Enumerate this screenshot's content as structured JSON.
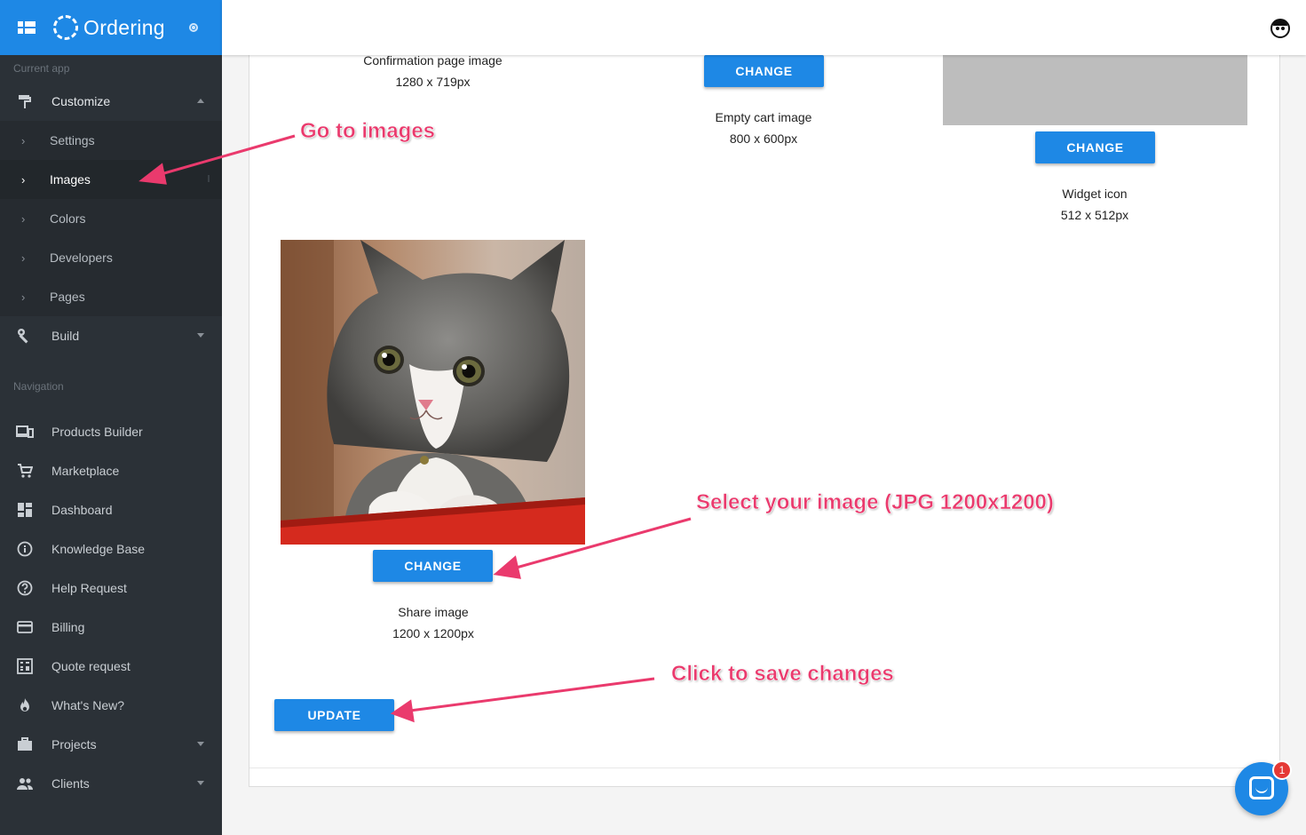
{
  "app": {
    "name": "Ordering"
  },
  "sidebar": {
    "current_app_label": "Current app",
    "customize": {
      "label": "Customize",
      "icon": "paint-roller-icon"
    },
    "customize_items": [
      {
        "label": "Settings"
      },
      {
        "label": "Images"
      },
      {
        "label": "Colors"
      },
      {
        "label": "Developers"
      },
      {
        "label": "Pages"
      }
    ],
    "build": {
      "label": "Build",
      "icon": "wrench-icon"
    },
    "navigation_label": "Navigation",
    "nav_items": [
      {
        "label": "Products Builder",
        "icon": "devices-icon"
      },
      {
        "label": "Marketplace",
        "icon": "cart-icon"
      },
      {
        "label": "Dashboard",
        "icon": "dashboard-icon"
      },
      {
        "label": "Knowledge Base",
        "icon": "info-icon"
      },
      {
        "label": "Help Request",
        "icon": "help-icon"
      },
      {
        "label": "Billing",
        "icon": "credit-card-icon"
      },
      {
        "label": "Quote request",
        "icon": "calculator-icon"
      },
      {
        "label": "What's New?",
        "icon": "fire-icon"
      },
      {
        "label": "Projects",
        "icon": "briefcase-icon"
      },
      {
        "label": "Clients",
        "icon": "people-icon"
      }
    ]
  },
  "images": {
    "confirmation": {
      "title": "Confirmation page image",
      "size": "1280 x 719px"
    },
    "empty_cart": {
      "title": "Empty cart image",
      "size": "800 x 600px",
      "button": "CHANGE"
    },
    "widget": {
      "title": "Widget icon",
      "size": "512 x 512px",
      "button": "CHANGE"
    },
    "share": {
      "title": "Share image",
      "size": "1200 x 1200px",
      "button": "CHANGE"
    }
  },
  "update_button": "UPDATE",
  "annotations": {
    "go_to_images": "Go to images",
    "select_image": "Select your image (JPG 1200x1200)",
    "save_changes": "Click to save changes"
  },
  "chat": {
    "badge": "1"
  },
  "colors": {
    "primary": "#1e88e5",
    "sidebar": "#2b3137",
    "annotation": "#ea3a6d"
  }
}
